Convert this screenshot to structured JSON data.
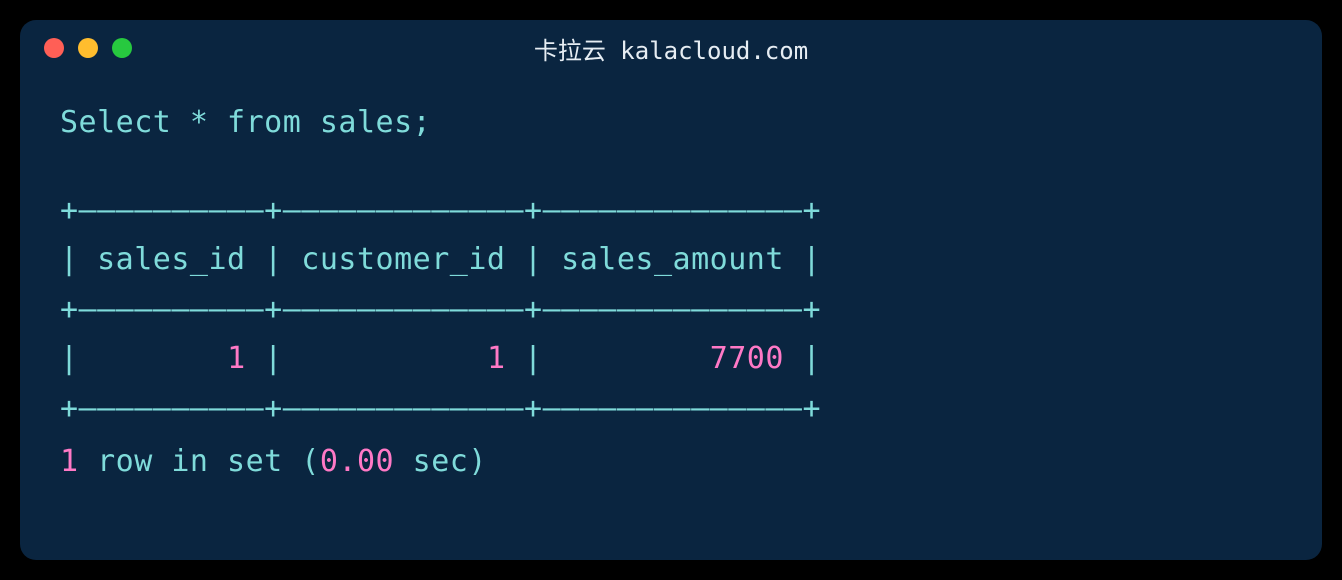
{
  "titlebar": {
    "title": "卡拉云 kalacloud.com"
  },
  "query": {
    "text": "Select * from sales;"
  },
  "table": {
    "border_top": "+——————————+—————————————+——————————————+",
    "header": "| sales_id | customer_id | sales_amount |",
    "border_mid": "+——————————+—————————————+——————————————+",
    "row_prefix": "|        ",
    "v1": "1",
    "row_sep1": " |           ",
    "v2": "1",
    "row_sep2": " |         ",
    "v3": "7700",
    "row_suffix": " |",
    "border_bot": "+——————————+—————————————+——————————————+"
  },
  "footer": {
    "count": "1",
    "text": " row in set (",
    "time": "0.00",
    "suffix": " sec)"
  }
}
